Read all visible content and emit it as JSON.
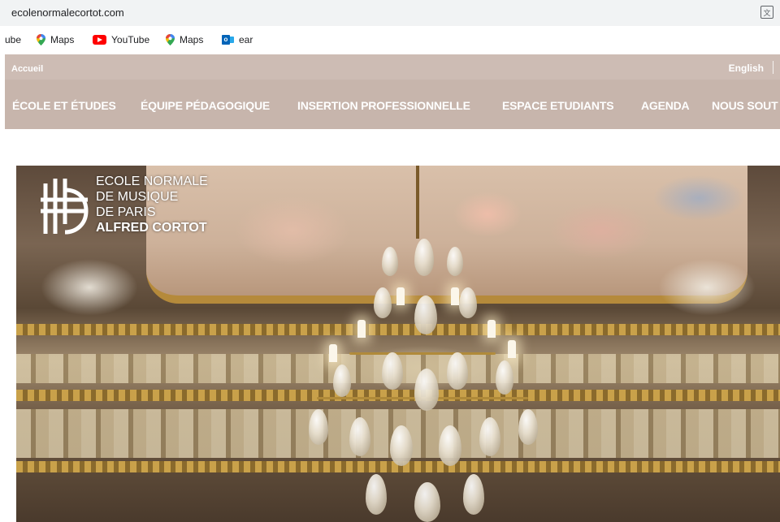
{
  "browser": {
    "url": "ecolenormalecortot.com",
    "translate_icon": "translate-icon"
  },
  "bookmarks": [
    {
      "label": "ube",
      "icon": "none"
    },
    {
      "label": "Maps",
      "icon": "google-maps-icon"
    },
    {
      "label": "YouTube",
      "icon": "youtube-icon"
    },
    {
      "label": "Maps",
      "icon": "google-maps-icon"
    },
    {
      "label": "ear",
      "icon": "outlook-icon"
    }
  ],
  "site": {
    "top": {
      "home_label": "Accueil",
      "language_label": "English"
    },
    "nav": [
      {
        "label": "ÉCOLE ET ÉTUDES"
      },
      {
        "label": "ÉQUIPE PÉDAGOGIQUE"
      },
      {
        "label": "INSERTION PROFESSIONNELLE"
      },
      {
        "label": "ESPACE ETUDIANTS"
      },
      {
        "label": "AGENDA"
      },
      {
        "label": "NOUS SOUT"
      }
    ],
    "logo": {
      "line1": "ECOLE NORMALE",
      "line2": "DE MUSIQUE",
      "line3": "DE PARIS",
      "line4": "ALFRED CORTOT"
    }
  },
  "colors": {
    "utility_bar": "#cdbcb4",
    "nav_bar": "#c7b5ac",
    "nav_text": "#ffffff"
  }
}
